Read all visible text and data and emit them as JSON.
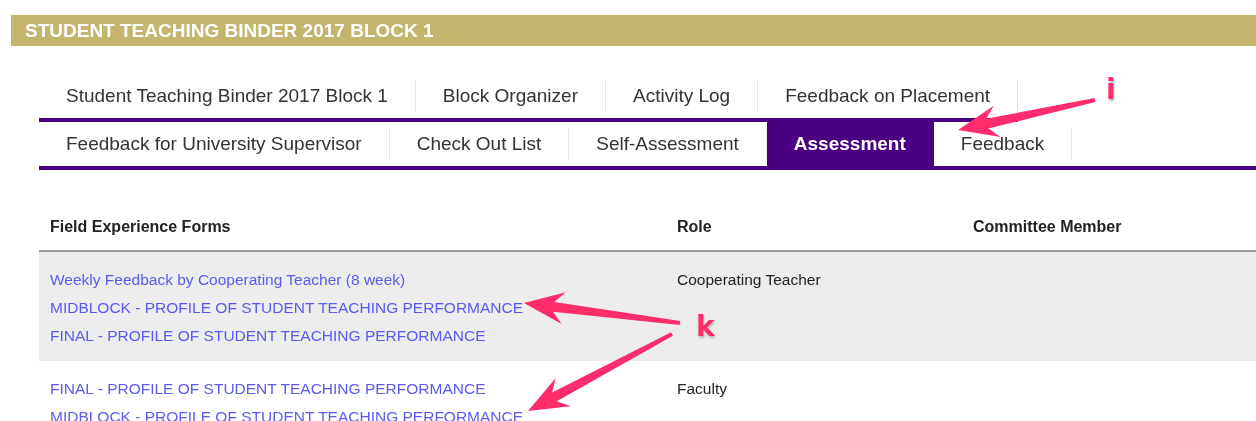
{
  "banner": {
    "title": "STUDENT TEACHING BINDER 2017 BLOCK 1"
  },
  "tab_rows": [
    [
      {
        "label": "Student Teaching Binder 2017 Block 1",
        "selected": false
      },
      {
        "label": "Block Organizer",
        "selected": false
      },
      {
        "label": "Activity Log",
        "selected": false
      },
      {
        "label": "Feedback on Placement",
        "selected": false
      }
    ],
    [
      {
        "label": "Feedback for University Supervisor",
        "selected": false
      },
      {
        "label": "Check Out List",
        "selected": false
      },
      {
        "label": "Self-Assessment",
        "selected": false
      },
      {
        "label": "Assessment",
        "selected": true
      },
      {
        "label": "Feedback",
        "selected": false
      }
    ]
  ],
  "table": {
    "columns": [
      "Field Experience Forms",
      "Role",
      "Committee Member"
    ],
    "rows": [
      {
        "forms": [
          "Weekly Feedback by Cooperating Teacher (8 week)",
          "MIDBLOCK - PROFILE OF STUDENT TEACHING PERFORMANCE",
          "FINAL - PROFILE OF STUDENT TEACHING PERFORMANCE"
        ],
        "role": "Cooperating Teacher"
      },
      {
        "forms": [
          "FINAL - PROFILE OF STUDENT TEACHING PERFORMANCE",
          "MIDBLOCK - PROFILE OF STUDENT TEACHING PERFORMANCE"
        ],
        "role": "Faculty"
      }
    ]
  },
  "annotations": [
    {
      "label": "i"
    },
    {
      "label": "k"
    }
  ]
}
